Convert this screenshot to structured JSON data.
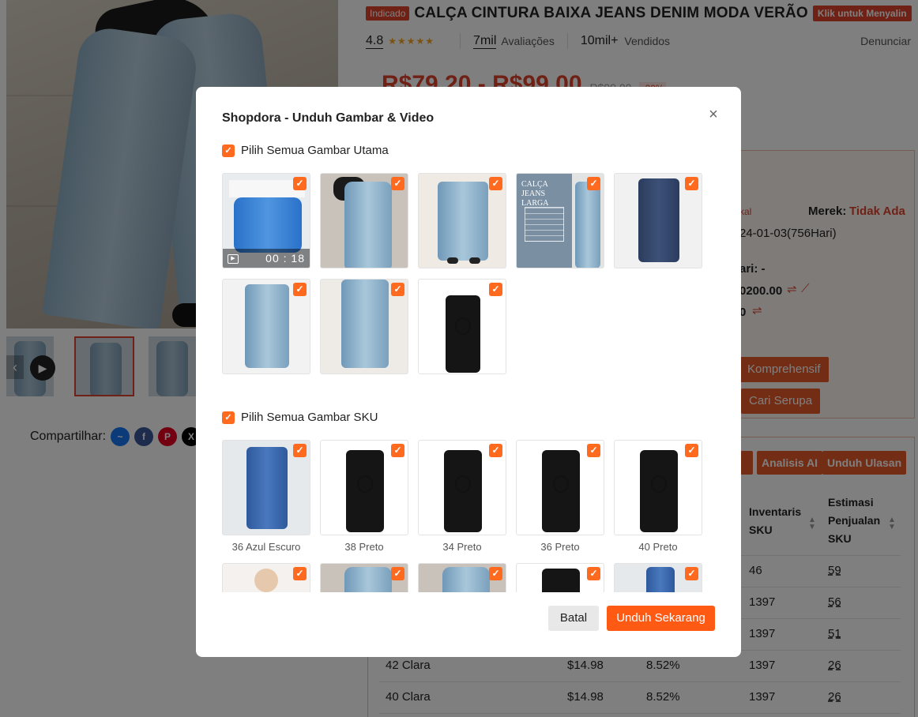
{
  "page": {
    "tag": "Indicado",
    "title": "CALÇA CINTURA BAIXA JEANS DENIM MODA VERÃO",
    "copy_button": "Klik untuk Menyalin",
    "rating": "4.8",
    "reviews_count": "7mil",
    "reviews_label": "Avaliações",
    "sold_count": "10mil+",
    "sold_label": "Vendidos",
    "report": "Denunciar",
    "price": "R$79,20 - R$99,00",
    "old_price": "R$99,00",
    "discount": "-20%",
    "share_label": "Compartilhar:",
    "share_icons": [
      "messenger-icon",
      "facebook-icon",
      "pinterest-icon",
      "x-icon"
    ]
  },
  "panel": {
    "tag_partial": "kal",
    "brand_label": "Merek:",
    "brand_value": "Tidak Ada",
    "date_partial": "24-01-03(756Hari)",
    "field_partial": "ari: -",
    "amount_partial": "0200.00",
    "amount2_partial": "0",
    "btn_comprehensive": "Komprehensif",
    "btn_similar": "Cari Serupa"
  },
  "sku_panel": {
    "btn_ai": "Analisis AI",
    "btn_reviews": "Unduh Ulasan",
    "col_inventory": [
      "Inventaris",
      "SKU"
    ],
    "col_sales": [
      "Estimasi",
      "Penjualan",
      "SKU"
    ],
    "rows": [
      {
        "name": "",
        "price": "",
        "pct": "",
        "inv": "46",
        "sales": "59"
      },
      {
        "name": "",
        "price": "",
        "pct": "",
        "inv": "1397",
        "sales": "56"
      },
      {
        "name": "",
        "price": "",
        "pct": "",
        "inv": "1397",
        "sales": "51"
      },
      {
        "name": "42 Clara",
        "price": "$14.98",
        "pct": "8.52%",
        "inv": "1397",
        "sales": "26"
      },
      {
        "name": "40 Clara",
        "price": "$14.98",
        "pct": "8.52%",
        "inv": "1397",
        "sales": "26"
      }
    ]
  },
  "modal": {
    "title": "Shopdora - Unduh Gambar & Video",
    "select_main": "Pilih Semua Gambar Utama",
    "select_sku": "Pilih Semua Gambar SKU",
    "video_duration": "00 : 18",
    "sku_labels": [
      "36 Azul Escuro",
      "38 Preto",
      "34 Preto",
      "36 Preto",
      "40 Preto"
    ],
    "size_card_title": "CALÇA JEANS LARGA",
    "cancel": "Batal",
    "download": "Unduh Sekarang"
  },
  "colors": {
    "accent": "#ff6a1f",
    "brand_red": "#e0432b",
    "download_button": "#ff5a14"
  }
}
